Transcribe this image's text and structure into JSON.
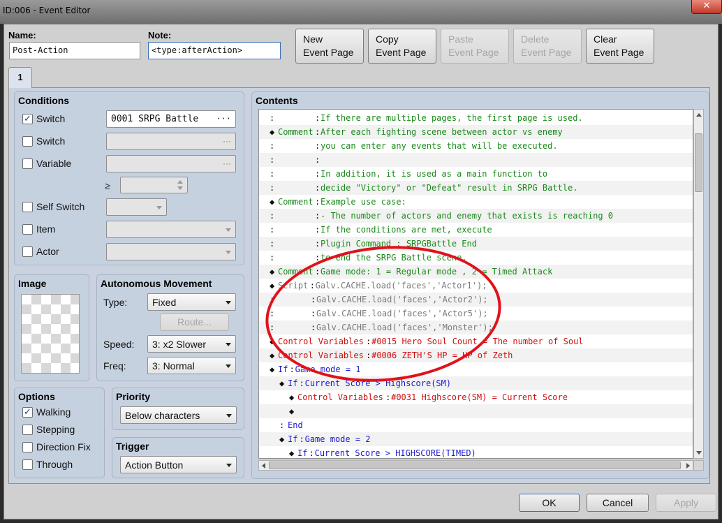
{
  "window": {
    "title": "ID:006 - Event Editor",
    "close_glyph": "✕"
  },
  "header": {
    "name_label": "Name:",
    "name_value": "Post-Action",
    "note_label": "Note:",
    "note_value": "<type:afterAction>",
    "buttons": {
      "new_page_l1": "New",
      "new_page_l2": "Event Page",
      "copy_page_l1": "Copy",
      "copy_page_l2": "Event Page",
      "paste_page_l1": "Paste",
      "paste_page_l2": "Event Page",
      "delete_page_l1": "Delete",
      "delete_page_l2": "Event Page",
      "clear_page_l1": "Clear",
      "clear_page_l2": "Event Page"
    }
  },
  "tabs": [
    {
      "label": "1"
    }
  ],
  "conditions": {
    "title": "Conditions",
    "switch1_label": "Switch",
    "switch1_checked": true,
    "switch1_value": "0001 SRPG Battle",
    "switch2_label": "Switch",
    "variable_label": "Variable",
    "compare_symbol": "≥",
    "self_switch_label": "Self Switch",
    "item_label": "Item",
    "actor_label": "Actor",
    "checkmark": "✓",
    "ellipsis": "···"
  },
  "image_panel": {
    "title": "Image"
  },
  "autonomous": {
    "title": "Autonomous Movement",
    "type_label": "Type:",
    "type_value": "Fixed",
    "route_label": "Route...",
    "speed_label": "Speed:",
    "speed_value": "3: x2 Slower",
    "freq_label": "Freq:",
    "freq_value": "3: Normal"
  },
  "options": {
    "title": "Options",
    "walking": "Walking",
    "walking_checked": true,
    "stepping": "Stepping",
    "direction_fix": "Direction Fix",
    "through": "Through"
  },
  "priority": {
    "title": "Priority",
    "value": "Below characters"
  },
  "trigger": {
    "title": "Trigger",
    "value": "Action Button"
  },
  "contents": {
    "title": "Contents",
    "rows": [
      {
        "indent": 0,
        "marker": ":",
        "label": "",
        "sep": ":",
        "text": "If there are multiple pages, the first page is used.",
        "color": "#1a8a1a"
      },
      {
        "indent": 0,
        "marker": "◆",
        "label": "Comment",
        "sep": ":",
        "text": "After each fighting scene between actor vs enemy",
        "color": "#1a8a1a"
      },
      {
        "indent": 0,
        "marker": ":",
        "label": "",
        "sep": ":",
        "text": "you can enter any events that will be executed.",
        "color": "#1a8a1a"
      },
      {
        "indent": 0,
        "marker": ":",
        "label": "",
        "sep": ":",
        "text": "",
        "color": "#1a8a1a"
      },
      {
        "indent": 0,
        "marker": ":",
        "label": "",
        "sep": ":",
        "text": "In addition, it is used as a main function to",
        "color": "#1a8a1a"
      },
      {
        "indent": 0,
        "marker": ":",
        "label": "",
        "sep": ":",
        "text": "decide \"Victory\" or \"Defeat\" result in SRPG Battle.",
        "color": "#1a8a1a"
      },
      {
        "indent": 0,
        "marker": "◆",
        "label": "Comment",
        "sep": ":",
        "text": "Example use case:",
        "color": "#1a8a1a"
      },
      {
        "indent": 0,
        "marker": ":",
        "label": "",
        "sep": ":",
        "text": "- The number of actors and enemy that exists is reaching 0",
        "color": "#1a8a1a"
      },
      {
        "indent": 0,
        "marker": ":",
        "label": "",
        "sep": ":",
        "text": "  If the conditions are met, execute",
        "color": "#1a8a1a"
      },
      {
        "indent": 0,
        "marker": ":",
        "label": "",
        "sep": ":",
        "text": "  Plugin Command : SRPGBattle End",
        "color": "#1a8a1a"
      },
      {
        "indent": 0,
        "marker": ":",
        "label": "",
        "sep": ":",
        "text": "  to end the SRPG Battle scene.",
        "color": "#1a8a1a"
      },
      {
        "indent": 0,
        "marker": "◆",
        "label": "Comment",
        "sep": ":",
        "text": "Game mode: 1 = Regular mode , 2 = Timed Attack",
        "color": "#1a8a1a"
      },
      {
        "indent": 0,
        "marker": "◆",
        "label": "Script",
        "sep": ":",
        "text": "Galv.CACHE.load('faces','Actor1');",
        "color": "#7a7a7a"
      },
      {
        "indent": 0,
        "marker": ":",
        "label": "",
        "sep": ":",
        "text": "Galv.CACHE.load('faces','Actor2');",
        "color": "#7a7a7a",
        "script": true
      },
      {
        "indent": 0,
        "marker": ":",
        "label": "",
        "sep": ":",
        "text": "Galv.CACHE.load('faces','Actor5');",
        "color": "#7a7a7a",
        "script": true
      },
      {
        "indent": 0,
        "marker": ":",
        "label": "",
        "sep": ":",
        "text": "Galv.CACHE.load('faces','Monster');",
        "color": "#7a7a7a",
        "script": true
      },
      {
        "indent": 0,
        "marker": "◆",
        "label": "Control Variables",
        "sep": ":",
        "text": "#0015 Hero Soul Count = The number of Soul",
        "color": "#d01010"
      },
      {
        "indent": 0,
        "marker": "◆",
        "label": "Control Variables",
        "sep": ":",
        "text": "#0006 ZETH'S HP = HP of Zeth",
        "color": "#d01010"
      },
      {
        "indent": 0,
        "marker": "◆",
        "label": "If",
        "sep": ":",
        "text": "Game mode = 1",
        "color": "#1a1ad0"
      },
      {
        "indent": 1,
        "marker": "◆",
        "label": "If",
        "sep": ":",
        "text": "Current Score > Highscore(SM)",
        "color": "#1a1ad0"
      },
      {
        "indent": 2,
        "marker": "◆",
        "label": "Control Variables",
        "sep": ":",
        "text": "#0031 Highscore(SM) = Current Score",
        "color": "#d01010"
      },
      {
        "indent": 2,
        "marker": "◆",
        "label": "",
        "sep": "",
        "text": "",
        "color": "#111111"
      },
      {
        "indent": 1,
        "marker": ":",
        "label": "End",
        "sep": "",
        "text": "",
        "color": "#1a1ad0"
      },
      {
        "indent": 1,
        "marker": "◆",
        "label": "If",
        "sep": ":",
        "text": "Game mode = 2",
        "color": "#1a1ad0"
      },
      {
        "indent": 2,
        "marker": "◆",
        "label": "If",
        "sep": ":",
        "text": "Current Score > HIGHSCORE(TIMED)",
        "color": "#1a1ad0"
      }
    ]
  },
  "footer": {
    "ok": "OK",
    "cancel": "Cancel",
    "apply": "Apply"
  },
  "annotation": {
    "color": "#e0121b"
  }
}
